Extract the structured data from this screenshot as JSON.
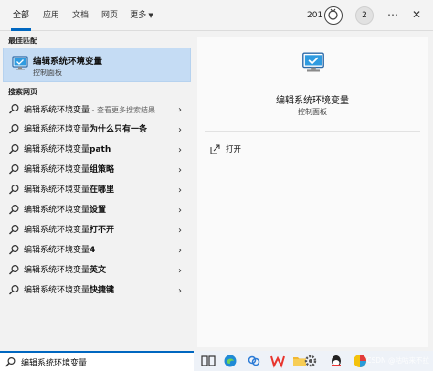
{
  "tabs": [
    {
      "label": "全部",
      "active": true
    },
    {
      "label": "应用",
      "active": false
    },
    {
      "label": "文档",
      "active": false
    },
    {
      "label": "网页",
      "active": false
    },
    {
      "label": "更多",
      "active": false
    }
  ],
  "header": {
    "points": "201",
    "avatar_letter": "2",
    "more_icon": "ellipsis-icon",
    "close_icon": "close-icon"
  },
  "best_match": {
    "section_label": "最佳匹配",
    "title": "编辑系统环境变量",
    "subtitle": "控制面板"
  },
  "web_search": {
    "section_label": "搜索网页",
    "query": "编辑系统环境变量",
    "first_hint": " - 查看更多搜索结果",
    "suggestions": [
      {
        "prefix": "编辑系统环境变量",
        "suffix": "为什么只有一条"
      },
      {
        "prefix": "编辑系统环境变量",
        "suffix": "path"
      },
      {
        "prefix": "编辑系统环境变量",
        "suffix": "组策略"
      },
      {
        "prefix": "编辑系统环境变量",
        "suffix": "在哪里"
      },
      {
        "prefix": "编辑系统环境变量",
        "suffix": "设置"
      },
      {
        "prefix": "编辑系统环境变量",
        "suffix": "打不开"
      },
      {
        "prefix": "编辑系统环境变量",
        "suffix": "4"
      },
      {
        "prefix": "编辑系统环境变量",
        "suffix": "英文"
      },
      {
        "prefix": "编辑系统环境变量",
        "suffix": "快捷键"
      }
    ]
  },
  "detail": {
    "title": "编辑系统环境变量",
    "subtitle": "控制面板",
    "action_open": "打开"
  },
  "search": {
    "value": "编辑系统环境变量"
  },
  "taskbar": {
    "icons": [
      "task-view-icon",
      "edge-icon",
      "photos-icon",
      "wps-icon",
      "file-explorer-icon",
      "settings-icon",
      "qq-icon",
      "colorful-app-icon"
    ]
  },
  "watermark": "CSDN @咕咕来不拉"
}
